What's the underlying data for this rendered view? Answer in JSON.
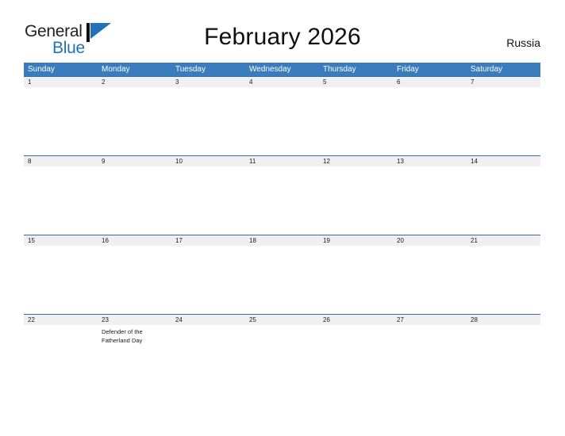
{
  "brand": {
    "name_top": "General",
    "name_bottom": "Blue",
    "flag_icon": "blue-flag-triangle-icon",
    "color_text": "#231f20",
    "color_blue": "#2272b8"
  },
  "header": {
    "title": "February 2026",
    "country": "Russia"
  },
  "theme": {
    "header_blue": "#3b7cbe",
    "rule_blue": "#2e6da4",
    "band_gray": "#f0f0f0"
  },
  "calendar": {
    "weekdays": [
      "Sunday",
      "Monday",
      "Tuesday",
      "Wednesday",
      "Thursday",
      "Friday",
      "Saturday"
    ],
    "weeks": [
      {
        "days": [
          {
            "num": "1",
            "event": ""
          },
          {
            "num": "2",
            "event": ""
          },
          {
            "num": "3",
            "event": ""
          },
          {
            "num": "4",
            "event": ""
          },
          {
            "num": "5",
            "event": ""
          },
          {
            "num": "6",
            "event": ""
          },
          {
            "num": "7",
            "event": ""
          }
        ]
      },
      {
        "days": [
          {
            "num": "8",
            "event": ""
          },
          {
            "num": "9",
            "event": ""
          },
          {
            "num": "10",
            "event": ""
          },
          {
            "num": "11",
            "event": ""
          },
          {
            "num": "12",
            "event": ""
          },
          {
            "num": "13",
            "event": ""
          },
          {
            "num": "14",
            "event": ""
          }
        ]
      },
      {
        "days": [
          {
            "num": "15",
            "event": ""
          },
          {
            "num": "16",
            "event": ""
          },
          {
            "num": "17",
            "event": ""
          },
          {
            "num": "18",
            "event": ""
          },
          {
            "num": "19",
            "event": ""
          },
          {
            "num": "20",
            "event": ""
          },
          {
            "num": "21",
            "event": ""
          }
        ]
      },
      {
        "days": [
          {
            "num": "22",
            "event": ""
          },
          {
            "num": "23",
            "event": "Defender of the Fatherland Day"
          },
          {
            "num": "24",
            "event": ""
          },
          {
            "num": "25",
            "event": ""
          },
          {
            "num": "26",
            "event": ""
          },
          {
            "num": "27",
            "event": ""
          },
          {
            "num": "28",
            "event": ""
          }
        ]
      }
    ]
  }
}
